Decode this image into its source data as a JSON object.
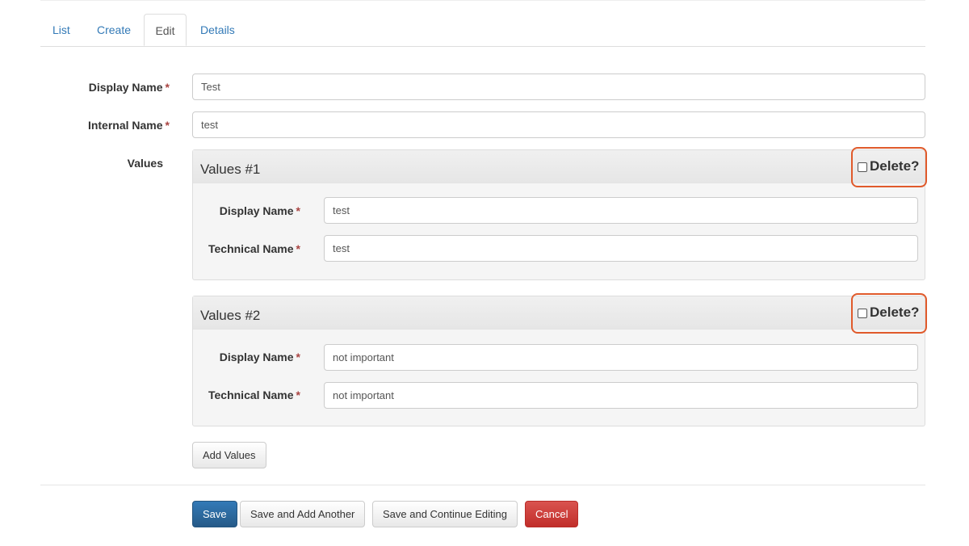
{
  "tabs": [
    {
      "label": "List",
      "active": false
    },
    {
      "label": "Create",
      "active": false
    },
    {
      "label": "Edit",
      "active": true
    },
    {
      "label": "Details",
      "active": false
    }
  ],
  "form": {
    "required_marker": "*",
    "display_name": {
      "label": "Display Name",
      "value": "Test"
    },
    "internal_name": {
      "label": "Internal Name",
      "value": "test"
    },
    "values_label": "Values",
    "values": [
      {
        "title": "Values #1",
        "delete_label": "Delete?",
        "delete_checked": false,
        "display_name": {
          "label": "Display Name",
          "value": "test"
        },
        "technical_name": {
          "label": "Technical Name",
          "value": "test"
        }
      },
      {
        "title": "Values #2",
        "delete_label": "Delete?",
        "delete_checked": false,
        "display_name": {
          "label": "Display Name",
          "value": "not important"
        },
        "technical_name": {
          "label": "Technical Name",
          "value": "not important"
        }
      }
    ],
    "add_values_label": "Add Values"
  },
  "actions": {
    "save": "Save",
    "save_add_another": "Save and Add Another",
    "save_continue": "Save and Continue Editing",
    "cancel": "Cancel"
  },
  "colors": {
    "link": "#337ab7",
    "primary": "#337ab7",
    "danger": "#d9534f",
    "highlight": "#e05a2b",
    "required": "#a94442"
  }
}
